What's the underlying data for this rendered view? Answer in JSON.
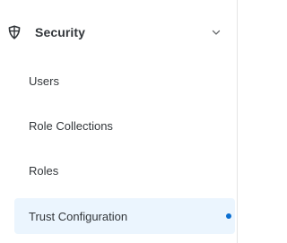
{
  "sidebar": {
    "group": {
      "label": "Security",
      "icon": "shield-icon",
      "expanded": true
    },
    "items": [
      {
        "label": "Users",
        "selected": false
      },
      {
        "label": "Role Collections",
        "selected": false
      },
      {
        "label": "Roles",
        "selected": false
      },
      {
        "label": "Trust Configuration",
        "selected": true
      }
    ],
    "colors": {
      "text": "#32363a",
      "selected_background": "#ebf5fe",
      "selected_indicator": "#0a6ed1"
    }
  }
}
